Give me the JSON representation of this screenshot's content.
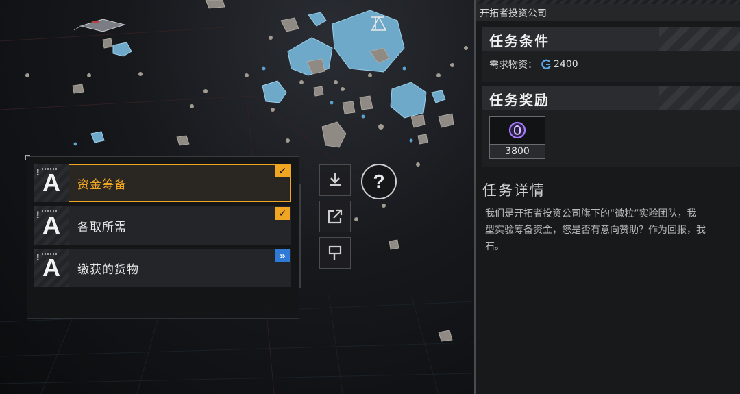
{
  "task_list": {
    "items": [
      {
        "grade": "A",
        "label": "资金筹备",
        "status": "completed",
        "selected": true
      },
      {
        "grade": "A",
        "label": "各取所需",
        "status": "completed",
        "selected": false
      },
      {
        "grade": "A",
        "label": "缴获的货物",
        "status": "in-progress",
        "selected": false
      }
    ],
    "grade_mark": "!"
  },
  "side_buttons": [
    "download-icon",
    "share-icon",
    "flag-icon"
  ],
  "help_button": {
    "label": "?"
  },
  "detail": {
    "company": "开拓者投资公司",
    "conditions": {
      "title": "任务条件",
      "requirement_label": "需求物资：",
      "requirement_amount": "2400",
      "requirement_icon": "resource-icon"
    },
    "rewards": {
      "title": "任务奖励",
      "items": [
        {
          "icon": "particle-currency-icon",
          "amount": "3800"
        }
      ]
    },
    "details": {
      "title": "任务详情",
      "text": "我们是开拓者投资公司旗下的“微粒”实验团队，我\n型实验筹备资金，您是否有意向赞助？作为回报，我\n石。"
    }
  },
  "colors": {
    "accent": "#f0a623",
    "progress_badge": "#2e7ad6",
    "reward_purple": "#a77bff"
  }
}
